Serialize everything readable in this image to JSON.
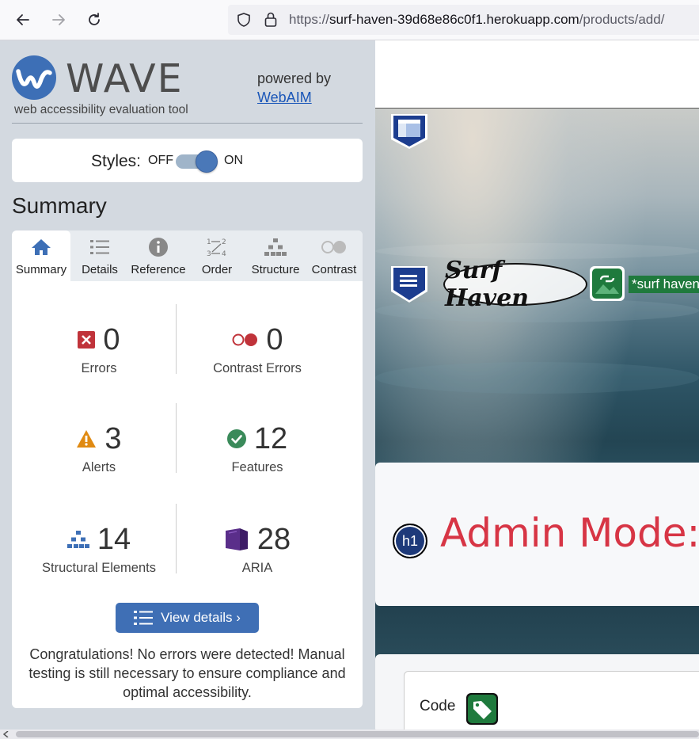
{
  "browser": {
    "url_prefix": "https://",
    "url_host": "surf-haven-39d68e86c0f1.herokuapp.com",
    "url_path": "/products/add/"
  },
  "wave": {
    "logo_word": "WAVE",
    "subtitle": "web accessibility evaluation tool",
    "powered_by": "powered by",
    "webaim_link": "WebAIM",
    "styles_label": "Styles:",
    "styles_off": "OFF",
    "styles_on": "ON",
    "styles_enabled": true,
    "summary_title": "Summary",
    "tabs": [
      {
        "label": "Summary",
        "icon": "home-icon",
        "active": true
      },
      {
        "label": "Details",
        "icon": "list-icon",
        "active": false
      },
      {
        "label": "Reference",
        "icon": "info-icon",
        "active": false
      },
      {
        "label": "Order",
        "icon": "order-icon",
        "active": false
      },
      {
        "label": "Structure",
        "icon": "structure-icon",
        "active": false
      },
      {
        "label": "Contrast",
        "icon": "contrast-icon",
        "active": false
      }
    ],
    "stats": {
      "errors": {
        "value": "0",
        "label": "Errors"
      },
      "contrast_errors": {
        "value": "0",
        "label": "Contrast Errors"
      },
      "alerts": {
        "value": "3",
        "label": "Alerts"
      },
      "features": {
        "value": "12",
        "label": "Features"
      },
      "structural": {
        "value": "14",
        "label": "Structural Elements"
      },
      "aria": {
        "value": "28",
        "label": "ARIA"
      }
    },
    "view_details": "View details ›",
    "congrats": "Congratulations! No errors were detected! Manual testing is still necessary to ensure compliance and optimal accessibility."
  },
  "page": {
    "logo_text": "Surf Haven",
    "alt_text": "*surf haven",
    "h1_badge": "h1",
    "admin_title": "Admin Mode: A",
    "code_label": "Code"
  },
  "colors": {
    "wave_sidebar": "#d3d9e0",
    "primary_blue": "#3f6fb5",
    "error_red": "#c0333a",
    "alert_orange": "#e08a12",
    "feature_green": "#3a8a5a",
    "aria_purple": "#5a2e8a",
    "admin_red": "#d73545"
  }
}
